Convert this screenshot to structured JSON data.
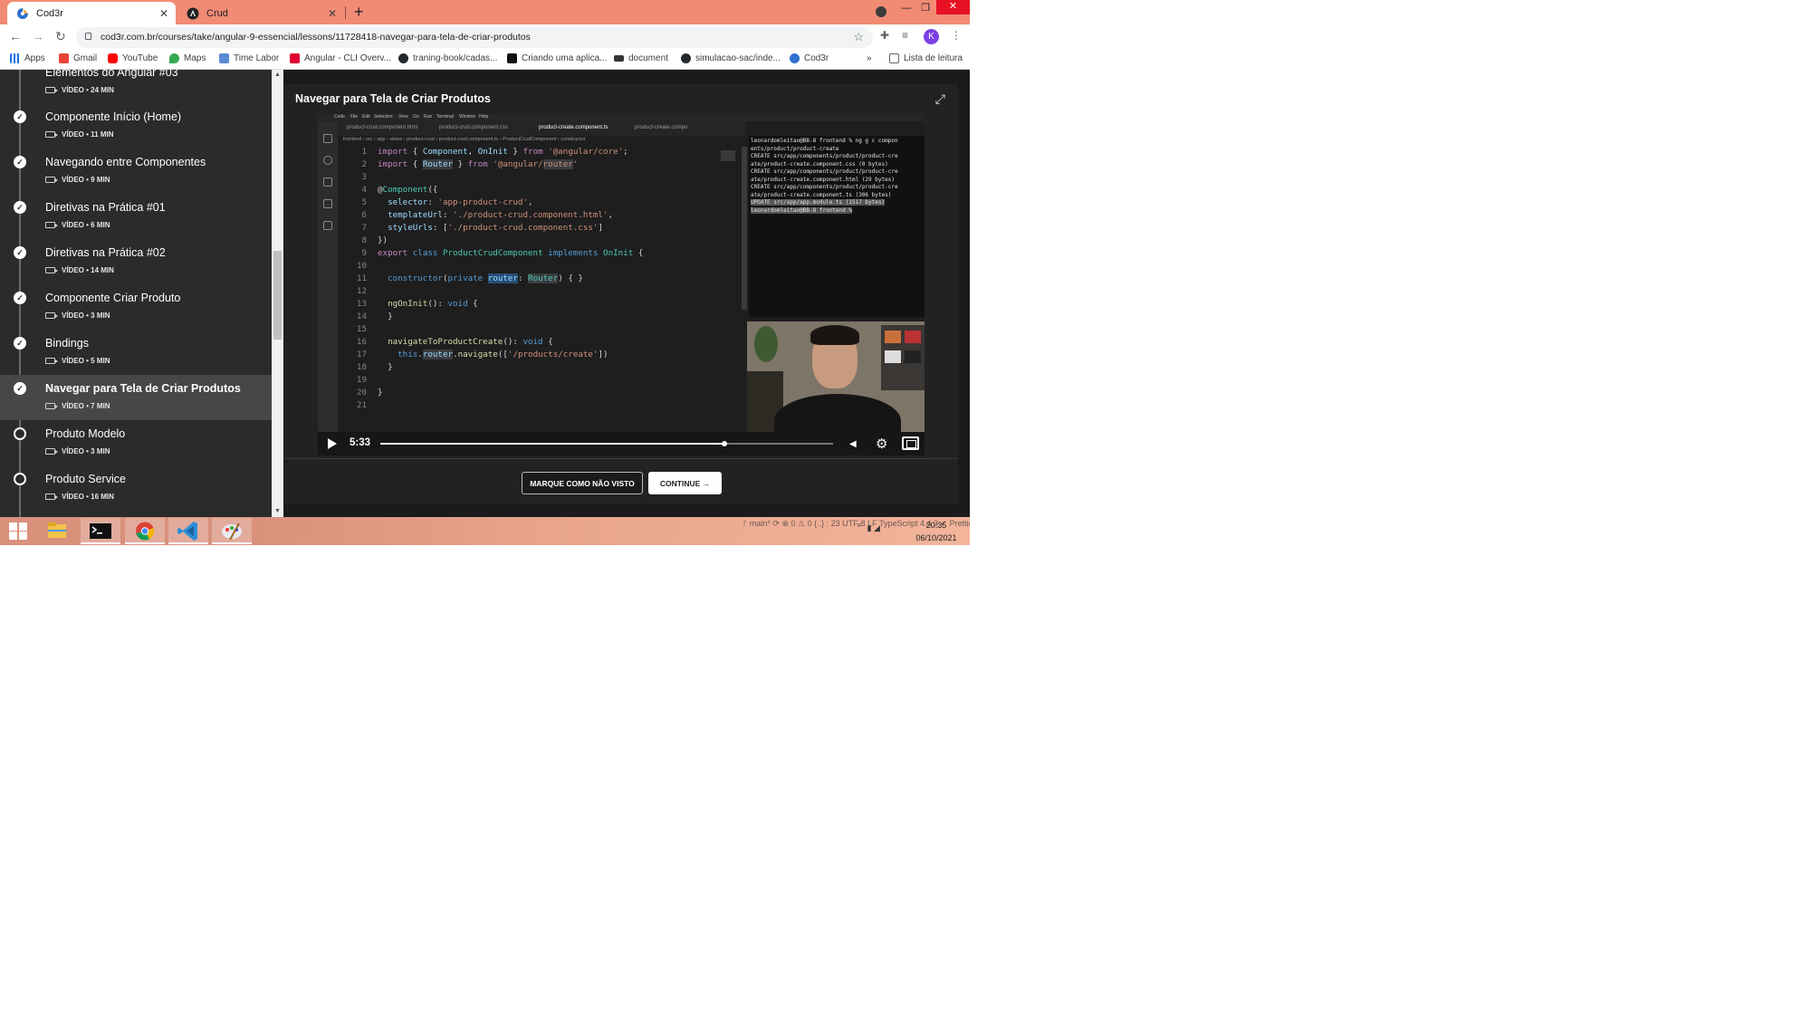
{
  "browser": {
    "tabs": [
      {
        "title": "Cod3r",
        "active": true
      },
      {
        "title": "Crud",
        "active": false
      }
    ],
    "url": "cod3r.com.br/courses/take/angular-9-essencial/lessons/11728418-navegar-para-tela-de-criar-produtos",
    "avatar_letter": "K",
    "bookmarks": [
      "Apps",
      "Gmail",
      "YouTube",
      "Maps",
      "Time Labor",
      "Angular - CLI Overv...",
      "traning-book/cadas...",
      "Criando uma aplica...",
      "document",
      "simulacao-sac/inde...",
      "Cod3r"
    ],
    "reading_list": "Lista de leitura",
    "overflow": "»"
  },
  "sidebar": {
    "partial_item_title": "Elementos do Angular #03",
    "partial_item_meta": "VÍDEO • 24 MIN",
    "lessons": [
      {
        "title": "Componente Início (Home)",
        "meta": "VÍDEO • 11 MIN",
        "done": true,
        "current": false
      },
      {
        "title": "Navegando entre Componentes",
        "meta": "VÍDEO • 9 MIN",
        "done": true,
        "current": false
      },
      {
        "title": "Diretivas na Prática #01",
        "meta": "VÍDEO • 6 MIN",
        "done": true,
        "current": false
      },
      {
        "title": "Diretivas na Prática #02",
        "meta": "VÍDEO • 14 MIN",
        "done": true,
        "current": false
      },
      {
        "title": "Componente Criar Produto",
        "meta": "VÍDEO • 3 MIN",
        "done": true,
        "current": false
      },
      {
        "title": "Bindings",
        "meta": "VÍDEO • 5 MIN",
        "done": true,
        "current": false
      },
      {
        "title": "Navegar para Tela de Criar Produtos",
        "meta": "VÍDEO • 7 MIN",
        "done": true,
        "current": true
      },
      {
        "title": "Produto Modelo",
        "meta": "VÍDEO • 3 MIN",
        "done": false,
        "current": false
      },
      {
        "title": "Produto Service",
        "meta": "VÍDEO • 16 MIN",
        "done": false,
        "current": false
      }
    ]
  },
  "lesson": {
    "title": "Navegar para Tela de Criar Produtos",
    "mark_button": "MARQUE COMO NÃO VISTO",
    "continue_button": "CONTINUE →"
  },
  "video": {
    "time": "5:33",
    "progress": 0.76,
    "editor_tabs": [
      "product-crud.component.html",
      "product-crud.component.css",
      "product-create.component.ts",
      "product-create.compo"
    ],
    "breadcrumb": "frontend › src › app › views › product-crud › product-crud.component.ts › ProductCrudComponent › constructor",
    "menubar": [
      "Code",
      "File",
      "Edit",
      "Selection",
      "View",
      "Go",
      "Run",
      "Terminal",
      "Window",
      "Help"
    ],
    "terminal_lines": [
      "leonardomleitao@BB-8 frontend % ng g c compon",
      "ents/product/product-create",
      "CREATE src/app/components/product/product-cre",
      "ate/product-create.component.css (0 bytes)",
      "CREATE src/app/components/product/product-cre",
      "ate/product-create.component.html (29 bytes)",
      "CREATE src/app/components/product/product-cre",
      "ate/product-create.component.ts (306 bytes)",
      "UPDATE src/app/app.module.ts (1517 bytes)",
      "leonardomleitao@BB-8 frontend % "
    ],
    "code_line_numbers": [
      "1",
      "2",
      "3",
      "4",
      "5",
      "6",
      "7",
      "8",
      "9",
      "10",
      "11",
      "12",
      "13",
      "14",
      "15",
      "16",
      "17",
      "18",
      "19",
      "20",
      "21"
    ]
  },
  "taskbar": {
    "time": "20:35",
    "date": "06/10/2021",
    "bg_status": "ᚠ main*    ⟳    ⊗ 0 ⚠ 0    {..} : 23              UTF-8    LF    TypeScript    4.4.3    ✓ Prettier    ⚲    ☖"
  }
}
